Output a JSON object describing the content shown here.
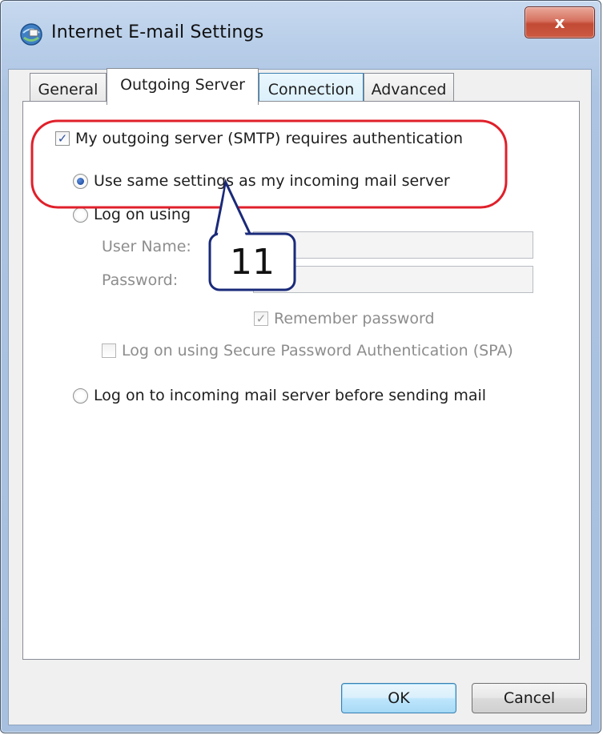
{
  "window": {
    "title": "Internet E-mail Settings",
    "close_label": "x"
  },
  "tabs": [
    {
      "label": "General",
      "active": false
    },
    {
      "label": "Outgoing Server",
      "active": true
    },
    {
      "label": "Connection",
      "active": false
    },
    {
      "label": "Advanced",
      "active": false
    }
  ],
  "outgoing": {
    "smtp_auth_label": "My outgoing server (SMTP) requires authentication",
    "smtp_auth_checked": true,
    "same_settings_label": "Use same settings as my incoming mail server",
    "same_settings_selected": true,
    "log_on_using_label": "Log on using",
    "log_on_using_selected": false,
    "user_name_label": "User Name:",
    "user_name_value": "",
    "password_label": "Password:",
    "password_value": "",
    "remember_password_label": "Remember password",
    "remember_password_checked": true,
    "spa_label": "Log on using Secure Password Authentication (SPA)",
    "spa_checked": false,
    "pop_before_smtp_label": "Log on to incoming mail server before sending mail",
    "pop_before_smtp_selected": false
  },
  "buttons": {
    "ok_label": "OK",
    "cancel_label": "Cancel"
  },
  "annotation": {
    "step_number": "11",
    "highlight_color": "#e0202a",
    "callout_color": "#1a2a7a"
  },
  "colors": {
    "frame": "#b7cde8",
    "close_button": "#c24a34",
    "checkbox_check": "#2a4f9e"
  }
}
